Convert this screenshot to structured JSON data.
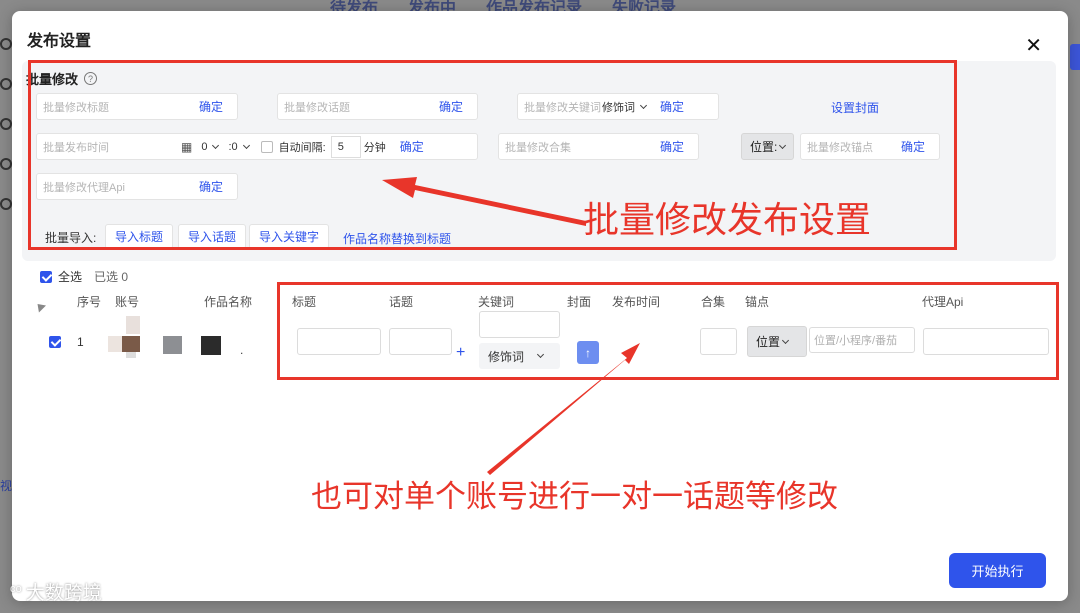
{
  "background": {
    "tabs": [
      "待发布",
      "发布中",
      "作品发布记录",
      "失败记录"
    ],
    "side_label": "视"
  },
  "modal": {
    "title": "发布设置",
    "close_glyph": "✕"
  },
  "batch": {
    "heading": "批量修改",
    "help_glyph": "?",
    "confirm_label": "确定",
    "title_placeholder": "批量修改标题",
    "topic_placeholder": "批量修改话题",
    "keyword_placeholder": "批量修改关键词",
    "modifier_select": "修饰词",
    "set_cover": "设置封面",
    "time_placeholder": "批量发布时间",
    "hour_value": "0",
    "minute_value": ":0",
    "auto_interval_label": "自动间隔:",
    "interval_value": "5",
    "interval_unit": "分钟",
    "collection_placeholder": "批量修改合集",
    "position_select": "位置:",
    "anchor_placeholder": "批量修改锚点",
    "proxy_placeholder": "批量修改代理Api",
    "import_label": "批量导入:",
    "import_buttons": [
      "导入标题",
      "导入话题",
      "导入关键字"
    ],
    "replace_link": "作品名称替换到标题"
  },
  "selection": {
    "select_all": "全选",
    "selected_count": "已选 0"
  },
  "table": {
    "headers": [
      "序号",
      "账号",
      "作品名称",
      "标题",
      "话题",
      "关键词",
      "封面",
      "发布时间",
      "合集",
      "锚点",
      "代理Api"
    ],
    "row": {
      "index": "1",
      "name_suffix": ".",
      "modifier_select": "修饰词",
      "position_select": "位置",
      "anchor_placeholder": "位置/小程序/番茄"
    }
  },
  "footer": {
    "start_button": "开始执行"
  },
  "annotations": {
    "batch_note": "批量修改发布设置",
    "row_note": "也可对单个账号进行一对一话题等修改",
    "color": "#e8352a"
  },
  "watermark": {
    "text": "大数跨境"
  },
  "colors": {
    "accent": "#2f54eb"
  }
}
